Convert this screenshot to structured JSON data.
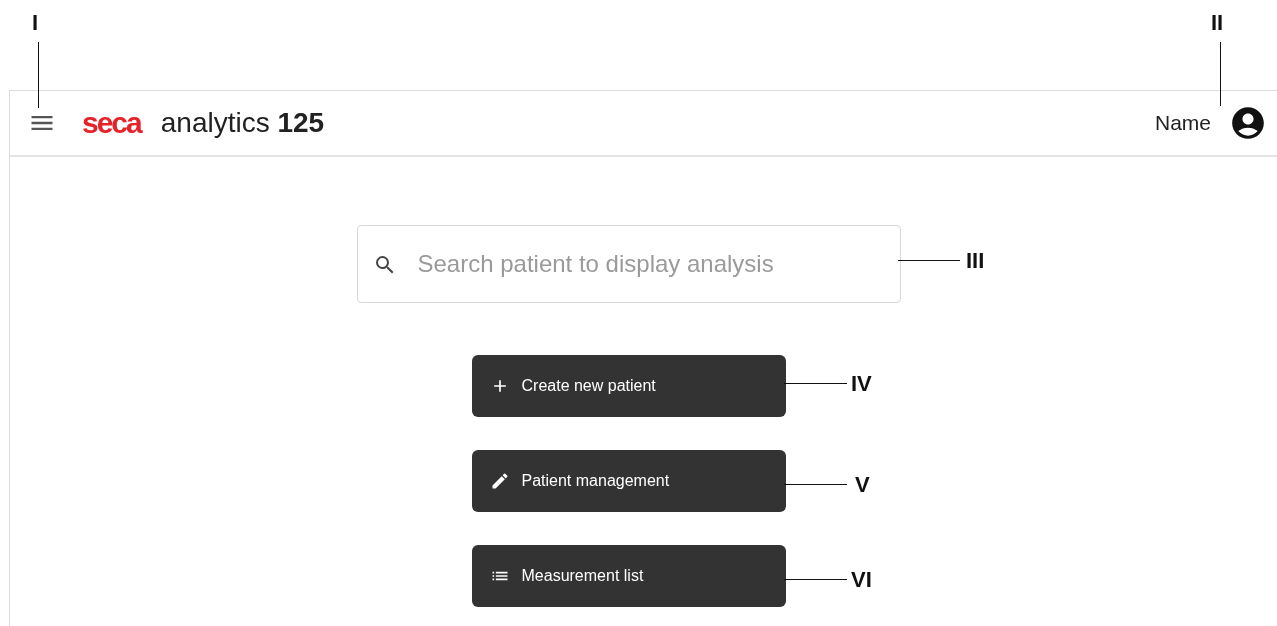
{
  "header": {
    "logo": "seca",
    "title": "analytics **125**",
    "user_name": "Name"
  },
  "search": {
    "placeholder": "Search patient to display analysis"
  },
  "buttons": [
    {
      "label": "Create new patient"
    },
    {
      "label": "Patient management"
    },
    {
      "label": "Measurement list"
    }
  ],
  "callouts": [
    {
      "label": "I"
    },
    {
      "label": "II"
    },
    {
      "label": "III"
    },
    {
      "label": "IV"
    },
    {
      "label": "V"
    },
    {
      "label": "VI"
    }
  ]
}
